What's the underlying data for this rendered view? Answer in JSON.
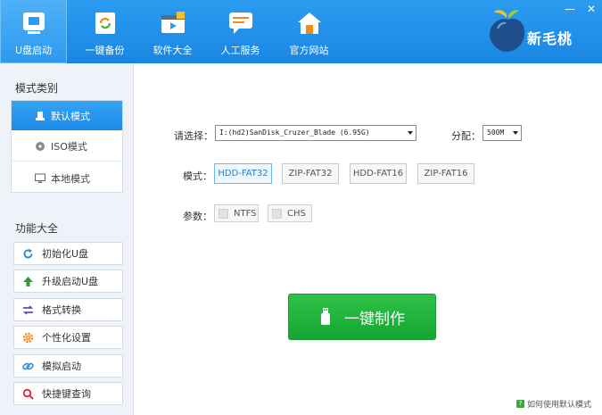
{
  "nav": [
    {
      "label": "U盘启动",
      "icon": "usb-drive-icon"
    },
    {
      "label": "一键备份",
      "icon": "backup-icon"
    },
    {
      "label": "软件大全",
      "icon": "software-icon"
    },
    {
      "label": "人工服务",
      "icon": "chat-icon"
    },
    {
      "label": "官方网站",
      "icon": "home-icon"
    }
  ],
  "brand": {
    "name": "新毛桃"
  },
  "window": {
    "minimize": "—",
    "close": "✕"
  },
  "sidebar": {
    "mode_title": "模式类别",
    "modes": [
      {
        "label": "默认模式",
        "icon": "usb-icon",
        "active": true
      },
      {
        "label": "ISO模式",
        "icon": "disc-icon",
        "active": false
      },
      {
        "label": "本地模式",
        "icon": "monitor-icon",
        "active": false
      }
    ],
    "func_title": "功能大全",
    "functions": [
      {
        "label": "初始化U盘",
        "icon": "refresh-icon"
      },
      {
        "label": "升级启动U盘",
        "icon": "up-arrow-icon"
      },
      {
        "label": "格式转换",
        "icon": "swap-icon"
      },
      {
        "label": "个性化设置",
        "icon": "gear-icon"
      },
      {
        "label": "模拟启动",
        "icon": "link-icon"
      },
      {
        "label": "快捷键查询",
        "icon": "search-icon"
      }
    ]
  },
  "main": {
    "select_label": "请选择：",
    "device": "I:(hd2)SanDisk_Cruzer_Blade (6.95G)",
    "alloc_label": "分配：",
    "alloc_value": "500M",
    "mode_label": "模式：",
    "modes": [
      {
        "label": "HDD-FAT32",
        "active": true
      },
      {
        "label": "ZIP-FAT32",
        "active": false
      },
      {
        "label": "HDD-FAT16",
        "active": false
      },
      {
        "label": "ZIP-FAT16",
        "active": false
      }
    ],
    "param_label": "参数：",
    "params": [
      {
        "label": "NTFS"
      },
      {
        "label": "CHS"
      }
    ],
    "make_button": "一键制作",
    "help_link": "如何使用默认模式",
    "help_icon": "?"
  },
  "colors": {
    "header": "#1a86e3",
    "accent": "#2b9cf0",
    "primary_button": "#17a534"
  }
}
